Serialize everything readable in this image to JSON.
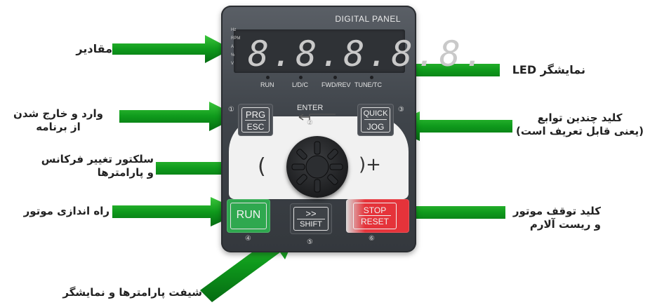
{
  "panel": {
    "brand": "DIGITAL PANEL",
    "display_digits": "8.8.8.8.8.",
    "units": [
      "Hz",
      "RPM",
      "A",
      "%",
      "V"
    ],
    "indicators": [
      "RUN",
      "L/D/C",
      "FWD/REV",
      "TUNE/TC"
    ],
    "enter_label": "ENTER",
    "enter_number": "②",
    "keys": {
      "prg": {
        "top": "PRG",
        "bottom": "ESC",
        "number": "①"
      },
      "quick": {
        "top": "QUICK",
        "bottom": "JOG",
        "number": "③"
      },
      "run": {
        "label": "RUN",
        "number": "④"
      },
      "shift": {
        "top": ">>",
        "bottom": "SHIFT",
        "number": "⑤"
      },
      "stop": {
        "top": "STOP",
        "bottom": "RESET",
        "number": "⑥"
      }
    },
    "minus": "(",
    "plus": ")+",
    "colors": {
      "run_key": "#2fa84f",
      "stop_key": "#e5333a",
      "arrow": "#0e8a1e"
    }
  },
  "labels": {
    "values": "مقادیر",
    "led_display": "نمایشگر LED",
    "prg_line1": "وارد و خارج شدن",
    "prg_line2": "از برنامه",
    "quick_line1": "کلید چندین توابع",
    "quick_line2": "(یعنی قابل تعریف است)",
    "selector_line1": "سلکتور تغییر فرکانس",
    "selector_line2": "و پارامترها",
    "run_motor": "راه اندازی موتور",
    "stop_line1": "کلید توقف موتور",
    "stop_line2": "و ریست آلارم",
    "shift_label": "شیفت پارامترها و نمایشگر"
  }
}
